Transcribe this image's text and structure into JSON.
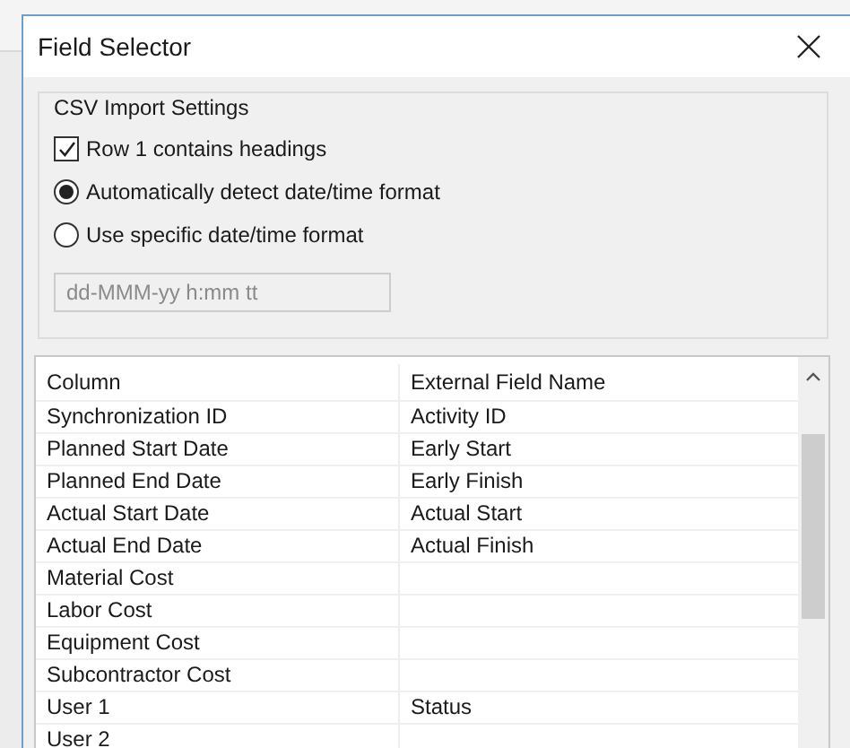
{
  "window": {
    "title": "Field Selector"
  },
  "csv_settings": {
    "title": "CSV Import Settings",
    "headings_checkbox": {
      "label": "Row 1 contains headings",
      "checked": true
    },
    "date_format_options": [
      {
        "label": "Automatically detect date/time format",
        "selected": true
      },
      {
        "label": "Use specific date/time format",
        "selected": false
      }
    ],
    "format_field": {
      "placeholder": "dd-MMM-yy h:mm tt",
      "disabled": true
    }
  },
  "table": {
    "columns": [
      "Column",
      "External Field Name"
    ],
    "rows": [
      [
        "Synchronization ID",
        "Activity ID"
      ],
      [
        "Planned Start Date",
        "Early Start"
      ],
      [
        "Planned End Date",
        "Early Finish"
      ],
      [
        "Actual Start Date",
        "Actual Start"
      ],
      [
        "Actual End Date",
        "Actual Finish"
      ],
      [
        "Material Cost",
        ""
      ],
      [
        "Labor Cost",
        ""
      ],
      [
        "Equipment Cost",
        ""
      ],
      [
        "Subcontractor Cost",
        ""
      ],
      [
        "User 1",
        "Status"
      ],
      [
        "User 2",
        ""
      ]
    ]
  }
}
